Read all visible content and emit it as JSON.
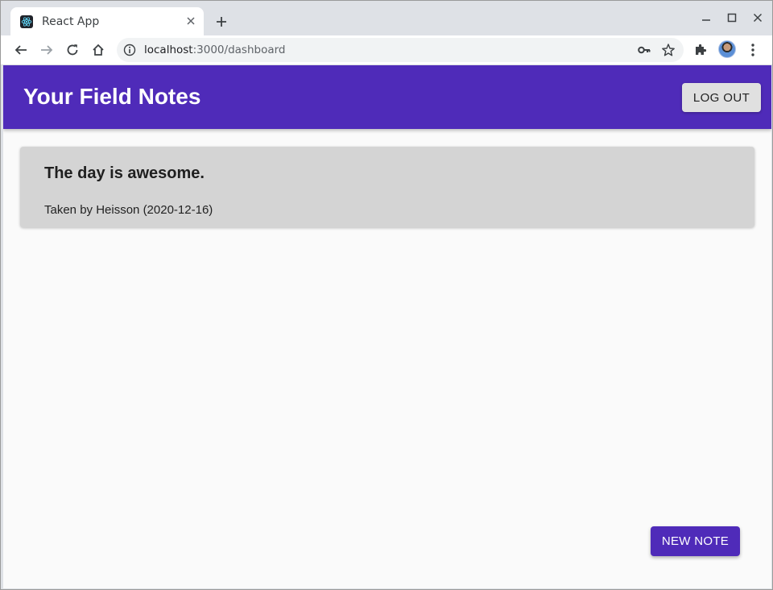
{
  "browser": {
    "tab_title": "React App",
    "url_host": "localhost",
    "url_path": ":3000/dashboard",
    "icons": [
      "react-favicon",
      "close-icon",
      "plus-icon",
      "minimize-icon",
      "maximize-icon",
      "close-window-icon",
      "back-arrow-icon",
      "forward-arrow-icon",
      "reload-icon",
      "home-icon",
      "info-icon",
      "key-icon",
      "star-icon",
      "puzzle-icon",
      "avatar",
      "kebab-menu-icon"
    ]
  },
  "app": {
    "title": "Your Field Notes",
    "logout_label": "LOG OUT",
    "primary_color": "#4f2bb9",
    "notes": [
      {
        "title": "The day is awesome.",
        "meta": "Taken by Heisson (2020-12-16)"
      }
    ],
    "new_note_label": "NEW NOTE"
  }
}
